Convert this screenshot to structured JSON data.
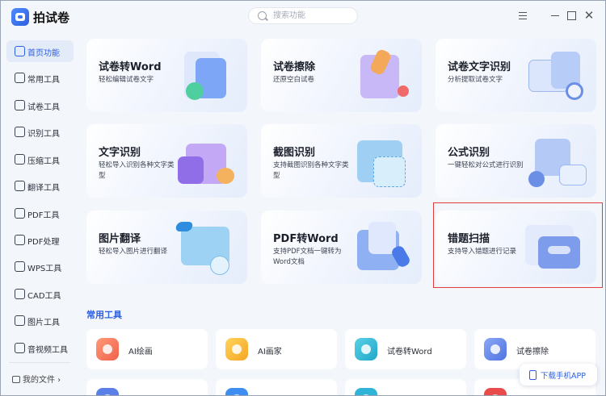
{
  "app": {
    "title": "拍试卷"
  },
  "search": {
    "placeholder": "搜索功能"
  },
  "window_controls": [
    "menu-icon",
    "minimize-icon",
    "maximize-icon",
    "close-icon"
  ],
  "sidebar": {
    "items": [
      {
        "label": "首页功能",
        "active": true,
        "icon": "home-icon"
      },
      {
        "label": "常用工具",
        "icon": "layers-icon"
      },
      {
        "label": "试卷工具",
        "icon": "paper-icon"
      },
      {
        "label": "识别工具",
        "icon": "scan-icon"
      },
      {
        "label": "压缩工具",
        "icon": "compress-icon"
      },
      {
        "label": "翻译工具",
        "icon": "translate-icon"
      },
      {
        "label": "PDF工具",
        "icon": "pdf-icon"
      },
      {
        "label": "PDF处理",
        "icon": "pdf-process-icon"
      },
      {
        "label": "WPS工具",
        "icon": "wps-icon"
      },
      {
        "label": "CAD工具",
        "icon": "cad-icon"
      },
      {
        "label": "图片工具",
        "icon": "image-icon"
      },
      {
        "label": "音视频工具",
        "icon": "media-icon"
      }
    ],
    "my_files": "我的文件 ›"
  },
  "cards": [
    {
      "title": "试卷转Word",
      "desc": "轻松编辑试卷文字",
      "icon": "paper-to-word-icon"
    },
    {
      "title": "试卷擦除",
      "desc": "还原空白试卷",
      "icon": "eraser-icon"
    },
    {
      "title": "试卷文字识别",
      "desc": "分析提取试卷文字",
      "icon": "paper-ocr-icon"
    },
    {
      "title": "文字识别",
      "desc": "轻松导入识别各种文字类型",
      "icon": "text-ocr-icon"
    },
    {
      "title": "截图识别",
      "desc": "支持截图识别各种文字类型",
      "icon": "screenshot-ocr-icon"
    },
    {
      "title": "公式识别",
      "desc": "一键轻松对公式进行识别",
      "icon": "formula-ocr-icon"
    },
    {
      "title": "图片翻译",
      "desc": "轻松导入图片进行翻译",
      "icon": "image-translate-icon"
    },
    {
      "title": "PDF转Word",
      "desc": "支持PDF文档一键转为Word文档",
      "icon": "pdf-to-word-icon"
    },
    {
      "title": "错题扫描",
      "desc": "支持导入错题进行记录",
      "icon": "mistake-scan-icon"
    }
  ],
  "section": {
    "title": "常用工具"
  },
  "tools": [
    {
      "label": "AI绘画",
      "icon": "ai-paint-icon"
    },
    {
      "label": "AI画家",
      "icon": "ai-artist-icon"
    },
    {
      "label": "试卷转Word",
      "icon": "paper-to-word-icon"
    },
    {
      "label": "试卷擦除",
      "icon": "eraser-icon"
    }
  ],
  "download": {
    "label": "下载手机APP"
  },
  "colors": {
    "accent": "#2d5fe0",
    "highlight": "#e23b3b"
  }
}
